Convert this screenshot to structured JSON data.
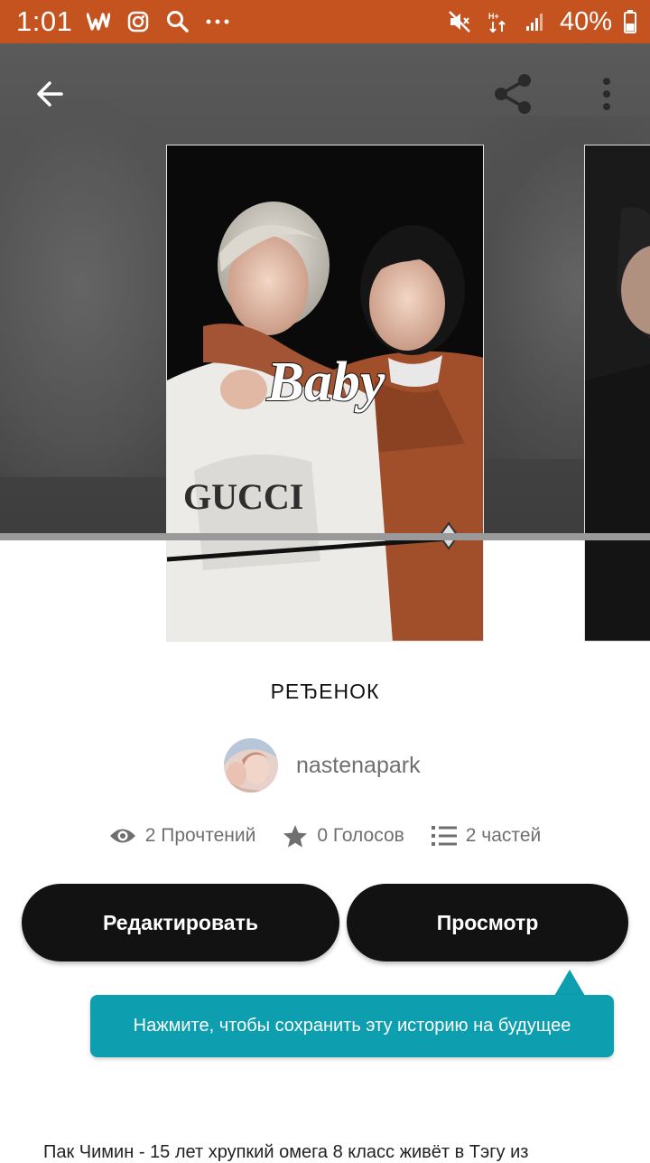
{
  "status_bar": {
    "time": "1:01",
    "battery": "40%",
    "app_icons": [
      "wattpad-icon",
      "instagram-icon",
      "search-icon",
      "more-icon"
    ],
    "system_icons": [
      "mute-icon",
      "data-icon",
      "signal-icon",
      "battery-icon"
    ]
  },
  "toolbar": {
    "back": "back-arrow-icon",
    "share": "share-icon",
    "more": "more-vertical-icon"
  },
  "cover": {
    "title_text": "Baby",
    "shirt_text": "GUCCI"
  },
  "story": {
    "title": "РЕЂЕНОК",
    "author": "nastenapark"
  },
  "stats": {
    "reads": "2 Прочтений",
    "votes": "0 Голосов",
    "parts": "2 частей"
  },
  "buttons": {
    "edit": "Редактировать",
    "view": "Просмотр"
  },
  "tooltip": {
    "text": "Нажмите, чтобы сохранить эту историю на будущее"
  },
  "description": {
    "text": "Пак Чимин - 15 лет хрупкий омега 8 класс живёт в Тэгу из"
  },
  "colors": {
    "status_bar": "#c5531f",
    "button": "#121212",
    "tooltip": "#0d9eb0"
  }
}
